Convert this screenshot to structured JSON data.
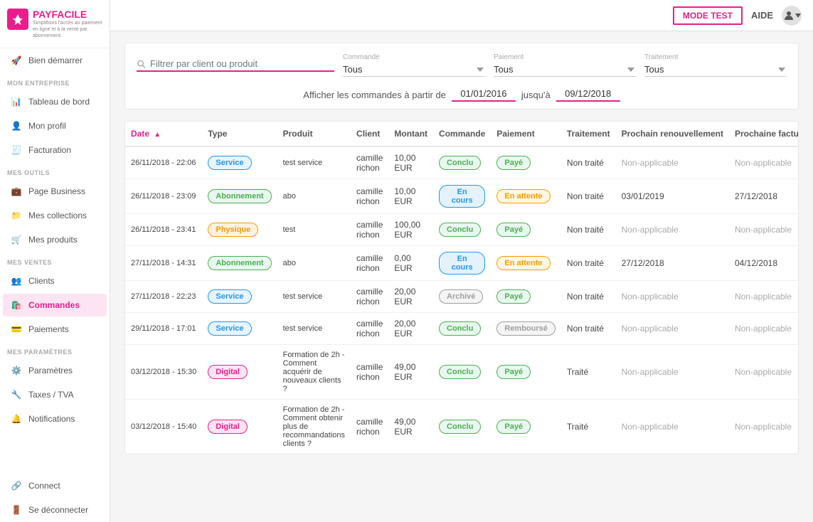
{
  "app": {
    "name": "PAYFACILE",
    "tagline": "Simplifions l'accès au paiement en ligne et à la vente par abonnement.",
    "mode_test_label": "MODE TEST",
    "aide_label": "AIDE"
  },
  "sidebar": {
    "top_item": {
      "label": "Bien démarrer",
      "icon": "rocket"
    },
    "sections": [
      {
        "label": "MON ENTREPRISE",
        "items": [
          {
            "id": "tableau-de-bord",
            "label": "Tableau de bord",
            "icon": "chart"
          },
          {
            "id": "mon-profil",
            "label": "Mon profil",
            "icon": "user"
          },
          {
            "id": "facturation",
            "label": "Facturation",
            "icon": "invoice"
          }
        ]
      },
      {
        "label": "MES OUTILS",
        "items": [
          {
            "id": "page-business",
            "label": "Page Business",
            "icon": "briefcase"
          },
          {
            "id": "mes-collections",
            "label": "Mes collections",
            "icon": "collection"
          },
          {
            "id": "mes-produits",
            "label": "Mes produits",
            "icon": "cart"
          }
        ]
      },
      {
        "label": "MES VENTES",
        "items": [
          {
            "id": "clients",
            "label": "Clients",
            "icon": "people"
          },
          {
            "id": "commandes",
            "label": "Commandes",
            "icon": "orders",
            "active": true
          },
          {
            "id": "paiements",
            "label": "Paiements",
            "icon": "payment"
          }
        ]
      },
      {
        "label": "MES PARAMÈTRES",
        "items": [
          {
            "id": "parametres",
            "label": "Paramètres",
            "icon": "gear"
          },
          {
            "id": "taxes-tva",
            "label": "Taxes / TVA",
            "icon": "tax"
          },
          {
            "id": "notifications",
            "label": "Notifications",
            "icon": "bell"
          }
        ]
      }
    ],
    "bottom_items": [
      {
        "id": "connect",
        "label": "Connect",
        "icon": "connect"
      },
      {
        "id": "se-deconnecter",
        "label": "Se déconnecter",
        "icon": "logout"
      }
    ]
  },
  "filter": {
    "search_placeholder": "Filtrer par client ou produit",
    "commande_label": "Commande",
    "commande_value": "Tous",
    "paiement_label": "Paiement",
    "paiement_value": "Tous",
    "traitement_label": "Traitement",
    "traitement_value": "Tous",
    "date_prefix": "Afficher les commandes à partir de",
    "date_from": "01/01/2016",
    "date_separator": "jusqu'à",
    "date_to": "09/12/2018"
  },
  "table": {
    "columns": [
      {
        "key": "date",
        "label": "Date",
        "sort": "asc"
      },
      {
        "key": "type",
        "label": "Type"
      },
      {
        "key": "produit",
        "label": "Produit"
      },
      {
        "key": "client",
        "label": "Client"
      },
      {
        "key": "montant",
        "label": "Montant"
      },
      {
        "key": "commande",
        "label": "Commande"
      },
      {
        "key": "paiement",
        "label": "Paiement"
      },
      {
        "key": "traitement",
        "label": "Traitement"
      },
      {
        "key": "prochain_renouv",
        "label": "Prochain renouvellement"
      },
      {
        "key": "prochaine_fact",
        "label": "Prochaine facturation"
      }
    ],
    "rows": [
      {
        "date": "26/11/2018 - 22:06",
        "type": "Service",
        "type_class": "service",
        "produit": "test service",
        "client": "camille richon",
        "montant": "10,00 EUR",
        "commande": "Conclu",
        "commande_class": "conclu",
        "paiement": "Payé",
        "paiement_class": "paye",
        "traitement": "Non traité",
        "prochain_renouv": "Non-applicable",
        "prochaine_fact": "Non-applicable"
      },
      {
        "date": "26/11/2018 - 23:09",
        "type": "Abonnement",
        "type_class": "abonnement",
        "produit": "abo",
        "client": "camille richon",
        "montant": "10,00 EUR",
        "commande": "En cours",
        "commande_class": "en-cours",
        "paiement": "En attente",
        "paiement_class": "en-attente",
        "traitement": "Non traité",
        "prochain_renouv": "03/01/2019",
        "prochaine_fact": "27/12/2018"
      },
      {
        "date": "26/11/2018 - 23:41",
        "type": "Physique",
        "type_class": "physique",
        "produit": "test",
        "client": "camille richon",
        "montant": "100,00 EUR",
        "commande": "Conclu",
        "commande_class": "conclu",
        "paiement": "Payé",
        "paiement_class": "paye",
        "traitement": "Non traité",
        "prochain_renouv": "Non-applicable",
        "prochaine_fact": "Non-applicable"
      },
      {
        "date": "27/11/2018 - 14:31",
        "type": "Abonnement",
        "type_class": "abonnement",
        "produit": "abo",
        "client": "camille richon",
        "montant": "0,00 EUR",
        "commande": "En cours",
        "commande_class": "en-cours",
        "paiement": "En attente",
        "paiement_class": "en-attente",
        "traitement": "Non traité",
        "prochain_renouv": "27/12/2018",
        "prochaine_fact": "04/12/2018"
      },
      {
        "date": "27/11/2018 - 22:23",
        "type": "Service",
        "type_class": "service",
        "produit": "test service",
        "client": "camille richon",
        "montant": "20,00 EUR",
        "commande": "Archivé",
        "commande_class": "archive",
        "paiement": "Payé",
        "paiement_class": "paye",
        "traitement": "Non traité",
        "prochain_renouv": "Non-applicable",
        "prochaine_fact": "Non-applicable"
      },
      {
        "date": "29/11/2018 - 17:01",
        "type": "Service",
        "type_class": "service",
        "produit": "test service",
        "client": "camille richon",
        "montant": "20,00 EUR",
        "commande": "Conclu",
        "commande_class": "conclu",
        "paiement": "Remboursé",
        "paiement_class": "rembourse",
        "traitement": "Non traité",
        "prochain_renouv": "Non-applicable",
        "prochaine_fact": "Non-applicable"
      },
      {
        "date": "03/12/2018 - 15:30",
        "type": "Digital",
        "type_class": "digital",
        "produit": "Formation de 2h - Comment acquérir de nouveaux clients ?",
        "client": "camille richon",
        "montant": "49,00 EUR",
        "commande": "Conclu",
        "commande_class": "conclu",
        "paiement": "Payé",
        "paiement_class": "paye",
        "traitement": "Traité",
        "prochain_renouv": "Non-applicable",
        "prochaine_fact": "Non-applicable"
      },
      {
        "date": "03/12/2018 - 15:40",
        "type": "Digital",
        "type_class": "digital",
        "produit": "Formation de 2h - Comment obtenir plus de recommandations clients ?",
        "client": "camille richon",
        "montant": "49,00 EUR",
        "commande": "Conclu",
        "commande_class": "conclu",
        "paiement": "Payé",
        "paiement_class": "paye",
        "traitement": "Traité",
        "prochain_renouv": "Non-applicable",
        "prochaine_fact": "Non-applicable"
      }
    ]
  }
}
